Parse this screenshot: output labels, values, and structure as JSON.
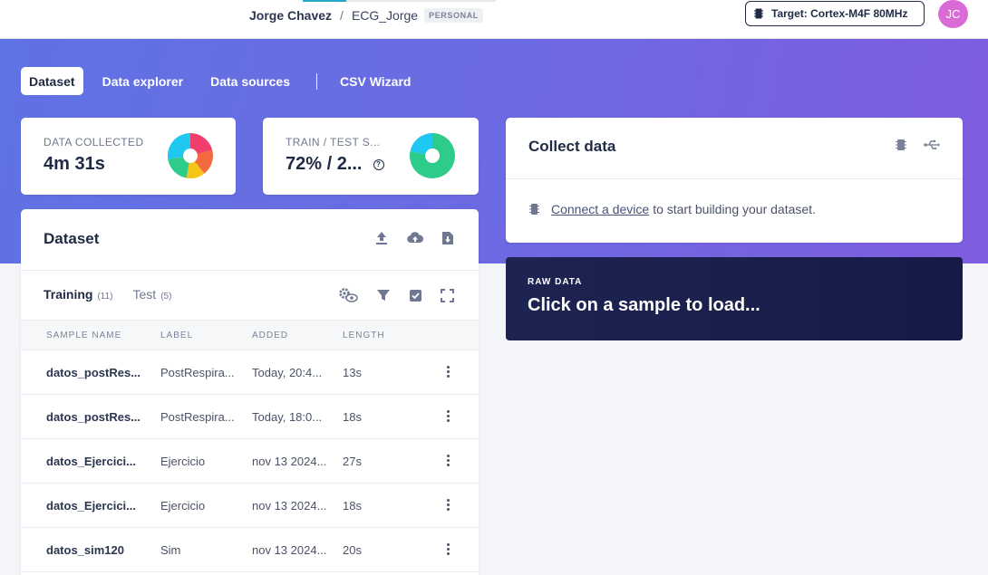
{
  "header": {
    "user": "Jorge Chavez",
    "separator": "/",
    "project": "ECG_Jorge",
    "badge": "PERSONAL",
    "target_label": "Target: Cortex-M4F 80MHz",
    "avatar_initials": "JC"
  },
  "tabs": [
    "Dataset",
    "Data explorer",
    "Data sources",
    "CSV Wizard"
  ],
  "stats": {
    "data_collected": {
      "label": "DATA COLLECTED",
      "value": "4m 31s"
    },
    "train_test": {
      "label": "TRAIN / TEST S...",
      "value": "72% / 2..."
    }
  },
  "collect": {
    "title": "Collect data",
    "link_text": "Connect a device",
    "message_rest": "to start building your dataset."
  },
  "raw_data": {
    "label": "RAW DATA",
    "title": "Click on a sample to load..."
  },
  "dataset": {
    "title": "Dataset",
    "subtabs": [
      {
        "label": "Training",
        "count": "(11)"
      },
      {
        "label": "Test",
        "count": "(5)"
      }
    ],
    "columns": [
      "SAMPLE NAME",
      "LABEL",
      "ADDED",
      "LENGTH"
    ],
    "rows": [
      {
        "name": "datos_postRes...",
        "label": "PostRespira...",
        "added": "Today, 20:4...",
        "length": "13s"
      },
      {
        "name": "datos_postRes...",
        "label": "PostRespira...",
        "added": "Today, 18:0...",
        "length": "18s"
      },
      {
        "name": "datos_Ejercici...",
        "label": "Ejercicio",
        "added": "nov 13 2024...",
        "length": "27s"
      },
      {
        "name": "datos_Ejercici...",
        "label": "Ejercicio",
        "added": "nov 13 2024...",
        "length": "18s"
      },
      {
        "name": "datos_sim120",
        "label": "Sim",
        "added": "nov 13 2024...",
        "length": "20s"
      }
    ]
  },
  "colors": {
    "accent": "#6c6ae2",
    "raw_panel": "#1e2452",
    "train_color": "#2ecc8a",
    "test_color": "#1ec8f0"
  },
  "icons": {
    "collect": [
      "chip-icon",
      "usb-icon"
    ],
    "dataset_actions": [
      "upload-icon",
      "cloud-upload-icon",
      "download-file-icon"
    ],
    "filters": [
      "gear-eye-icon",
      "filter-icon",
      "checkbox-icon",
      "expand-icon"
    ]
  }
}
